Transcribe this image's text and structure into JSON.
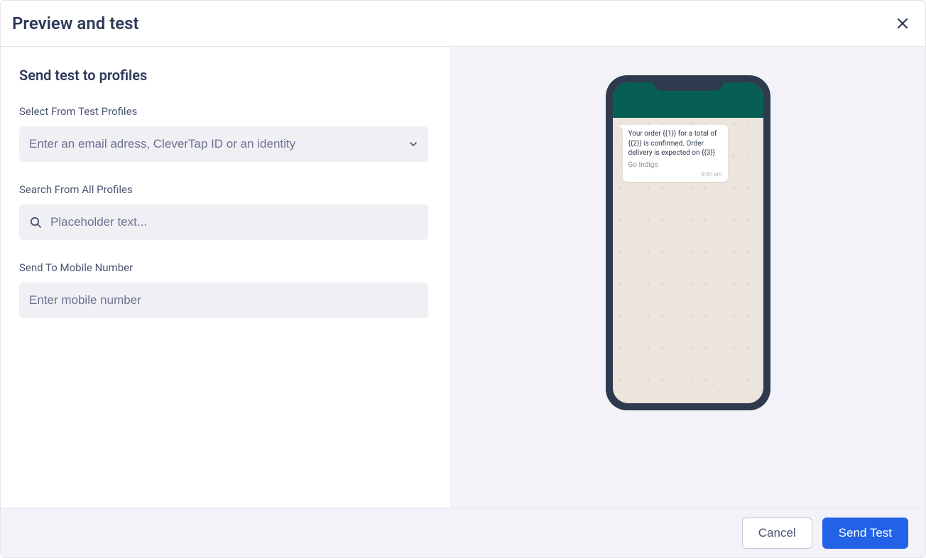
{
  "header": {
    "title": "Preview and test"
  },
  "left": {
    "section_title": "Send test to profiles",
    "field1": {
      "label": "Select From Test Profiles",
      "placeholder": "Enter an email adress, CleverTap ID or an identity"
    },
    "field2": {
      "label": "Search From All Profiles",
      "placeholder": "Placeholder text..."
    },
    "field3": {
      "label": "Send To Mobile Number",
      "placeholder": "Enter mobile number"
    }
  },
  "preview": {
    "message_text": "Your order {{1}} for a total of {{2}} is confirmed. Order delivery is expected on {{3}}",
    "link_text": "Go Indigo",
    "time": "9:41 pm"
  },
  "footer": {
    "cancel": "Cancel",
    "send": "Send Test"
  },
  "colors": {
    "primary": "#2262e6",
    "text": "#2e3a59",
    "bg_muted": "#f3f2f8",
    "input_bg": "#f0f0f4",
    "wa_header": "#075e54",
    "wa_body": "#ece5dd"
  }
}
